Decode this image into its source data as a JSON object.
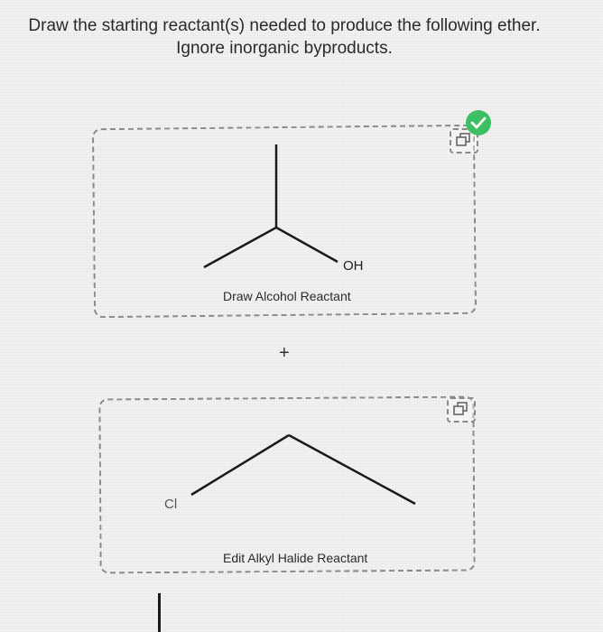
{
  "question": {
    "line1": "Draw the starting reactant(s) needed to produce the following ether.",
    "line2": "Ignore inorganic byproducts."
  },
  "alcohol_box": {
    "atom_label": "OH",
    "caption": "Draw Alcohol Reactant",
    "status_icon": "check-icon",
    "status_color": "#3dbf64",
    "action_icon": "copy-icon"
  },
  "plus_sign": "+",
  "halide_box": {
    "atom_label": "Cl",
    "caption": "Edit Alkyl Halide Reactant",
    "action_icon": "copy-icon"
  }
}
